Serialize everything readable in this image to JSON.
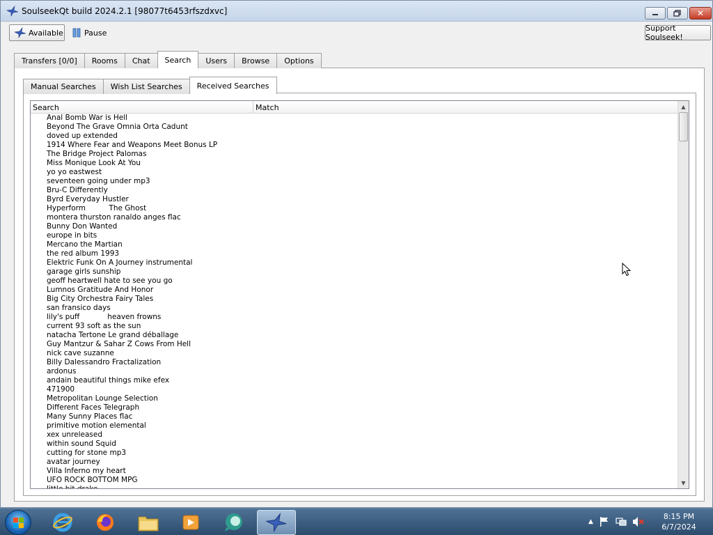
{
  "window": {
    "title": "SoulseekQt build 2024.2.1 [98077t6453rfszdxvc]",
    "minimize_label": "",
    "close_label": "✕"
  },
  "toolbar": {
    "available_label": "Available",
    "pause_label": "Pause",
    "support_label": "Support Soulseek!"
  },
  "main_tabs": [
    "Transfers [0/0]",
    "Rooms",
    "Chat",
    "Search",
    "Users",
    "Browse",
    "Options"
  ],
  "main_tab_active": "Search",
  "sub_tabs": [
    "Manual Searches",
    "Wish List Searches",
    "Received Searches"
  ],
  "sub_tab_active": "Received Searches",
  "table": {
    "columns": [
      "Search",
      "Match"
    ],
    "rows": [
      "Anal Bomb War is Hell",
      "Beyond The Grave Omnia Orta Cadunt",
      "doved up extended",
      "1914 Where Fear and Weapons Meet Bonus LP",
      "The Bridge Project Palomas",
      "Miss Monique Look At You",
      "yo yo eastwest",
      "seventeen going under mp3",
      "Bru-C Differently",
      "Byrd Everyday Hustler",
      "Hyperform          The Ghost",
      "montera thurston ranaldo anges flac",
      "Bunny Don Wanted",
      "europe in bits",
      "Mercano the Martian",
      "the red album 1993",
      "Elektric Funk On A Journey instrumental",
      "garage girls sunship",
      "geoff heartwell hate to see you go",
      "Lumnos Gratitude And Honor",
      "Big City Orchestra Fairy Tales",
      "san fransico days",
      "lily's puff            heaven frowns",
      "current 93 soft as the sun",
      "natacha Tertone Le grand déballage",
      "Guy Mantzur & Sahar Z Cows From Hell",
      "nick cave suzanne",
      "Billy Dalessandro Fractalization",
      "ardonus",
      "andain beautiful things mike efex",
      "471900",
      "Metropolitan Lounge Selection",
      "Different Faces Telegraph",
      "Many Sunny Places flac",
      "primitive motion elemental",
      "xex unreleased",
      "within sound Squid",
      "cutting for stone mp3",
      "avatar journey",
      "Villa Inferno my heart",
      "UFO ROCK BOTTOM MPG",
      "little bit drake"
    ]
  },
  "clock": {
    "time": "8:15 PM",
    "date": "6/7/2024"
  },
  "colors": {
    "taskbar": "#2c4c6c",
    "titlebar": "#c4d5ea",
    "close_button": "#c43b26"
  }
}
